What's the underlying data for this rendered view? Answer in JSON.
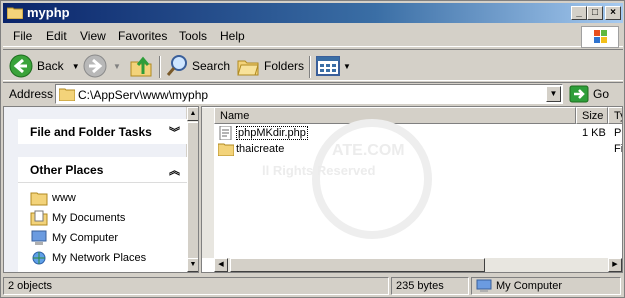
{
  "window": {
    "title": "myphp"
  },
  "menu": {
    "items": [
      "File",
      "Edit",
      "View",
      "Favorites",
      "Tools",
      "Help"
    ]
  },
  "toolbar": {
    "back_label": "Back",
    "search_label": "Search",
    "folders_label": "Folders"
  },
  "address": {
    "label": "Address",
    "value": "C:\\AppServ\\www\\myphp",
    "go_label": "Go"
  },
  "tasks": {
    "file_folder_tasks": "File and Folder Tasks",
    "other_places": "Other Places",
    "places": [
      "www",
      "My Documents",
      "My Computer",
      "My Network Places"
    ]
  },
  "list": {
    "columns": {
      "name": "Name",
      "size": "Size",
      "type": "Ty"
    },
    "rows": [
      {
        "name": "phpMKdir.php",
        "size": "1 KB",
        "type": "Pl"
      },
      {
        "name": "thaicreate",
        "size": "",
        "type": "Fi"
      }
    ]
  },
  "watermark": {
    "line1": "ATE.COM",
    "line2": "ll Rights Reserved"
  },
  "status": {
    "objects": "2 objects",
    "bytes": "235 bytes",
    "location": "My Computer"
  },
  "colors": {
    "title_start": "#0a246a",
    "title_end": "#a6caf0",
    "chrome": "#d4d0c8",
    "go_green": "#2e9e3a"
  }
}
